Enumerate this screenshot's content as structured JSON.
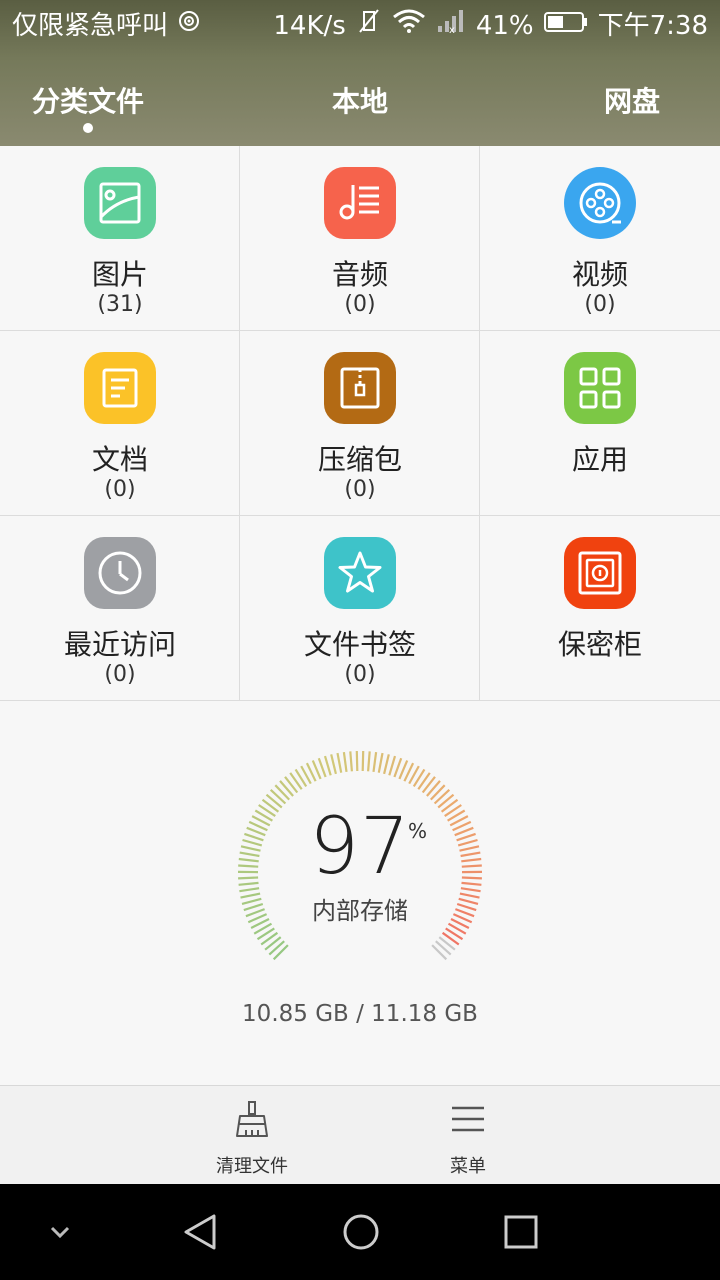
{
  "status_bar": {
    "carrier": "仅限紧急呼叫",
    "speed": "14K/s",
    "battery": "41%",
    "time": "下午7:38"
  },
  "tabs": [
    {
      "label": "分类文件",
      "active": true
    },
    {
      "label": "本地",
      "active": false
    },
    {
      "label": "网盘",
      "active": false
    }
  ],
  "categories": [
    {
      "label": "图片",
      "count": "(31)",
      "icon": "image-icon",
      "color": "#5fcf9a"
    },
    {
      "label": "音频",
      "count": "(0)",
      "icon": "music-icon",
      "color": "#f6634c"
    },
    {
      "label": "视频",
      "count": "(0)",
      "icon": "film-reel-icon",
      "color": "#3aa6ef"
    },
    {
      "label": "文档",
      "count": "(0)",
      "icon": "document-icon",
      "color": "#fbc228"
    },
    {
      "label": "压缩包",
      "count": "(0)",
      "icon": "archive-icon",
      "color": "#b36a14"
    },
    {
      "label": "应用",
      "count": "",
      "icon": "apps-grid-icon",
      "color": "#7cc845"
    },
    {
      "label": "最近访问",
      "count": "(0)",
      "icon": "clock-icon",
      "color": "#9ea0a4"
    },
    {
      "label": "文件书签",
      "count": "(0)",
      "icon": "star-icon",
      "color": "#3ec3c9"
    },
    {
      "label": "保密柜",
      "count": "",
      "icon": "safe-icon",
      "color": "#f0420f"
    }
  ],
  "storage": {
    "percent": "97",
    "percent_sign": "%",
    "label": "内部存储",
    "used_total": "10.85 GB / 11.18 GB",
    "fraction_used": 0.97
  },
  "toolbar": {
    "clean_label": "清理文件",
    "menu_label": "菜单"
  },
  "navbar": {
    "icons": [
      "chevron-down-icon",
      "back-icon",
      "home-icon",
      "recents-icon"
    ]
  }
}
